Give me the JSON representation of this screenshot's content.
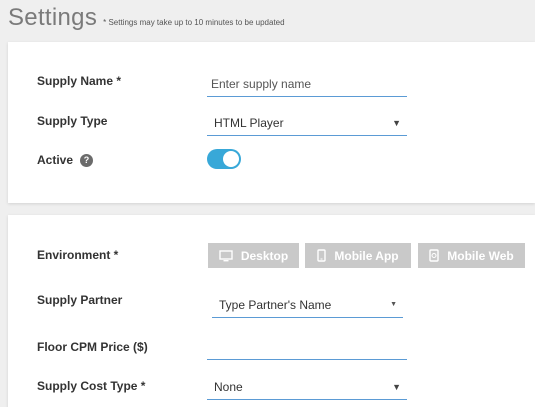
{
  "header": {
    "title": "Settings",
    "note": "* Settings may take up to 10 minutes to be updated"
  },
  "general": {
    "supply_name_label": "Supply Name *",
    "supply_name_placeholder": "Enter supply name",
    "supply_type_label": "Supply Type",
    "supply_type_value": "HTML Player",
    "active_label": "Active",
    "active_help": "?",
    "active_on": true
  },
  "config": {
    "environment_label": "Environment *",
    "environment_options": [
      {
        "label": "Desktop",
        "icon": "monitor-icon"
      },
      {
        "label": "Mobile App",
        "icon": "smartphone-icon"
      },
      {
        "label": "Mobile Web",
        "icon": "mobile-web-icon"
      }
    ],
    "partner_label": "Supply Partner",
    "partner_placeholder": "Type Partner's Name",
    "floor_label": "Floor CPM Price ($)",
    "floor_value": "",
    "cost_type_label": "Supply Cost Type *",
    "cost_type_value": "None"
  },
  "colors": {
    "accent": "#38a8d8",
    "underline": "#5b9bd5",
    "button_disabled": "#c9c9c9"
  }
}
